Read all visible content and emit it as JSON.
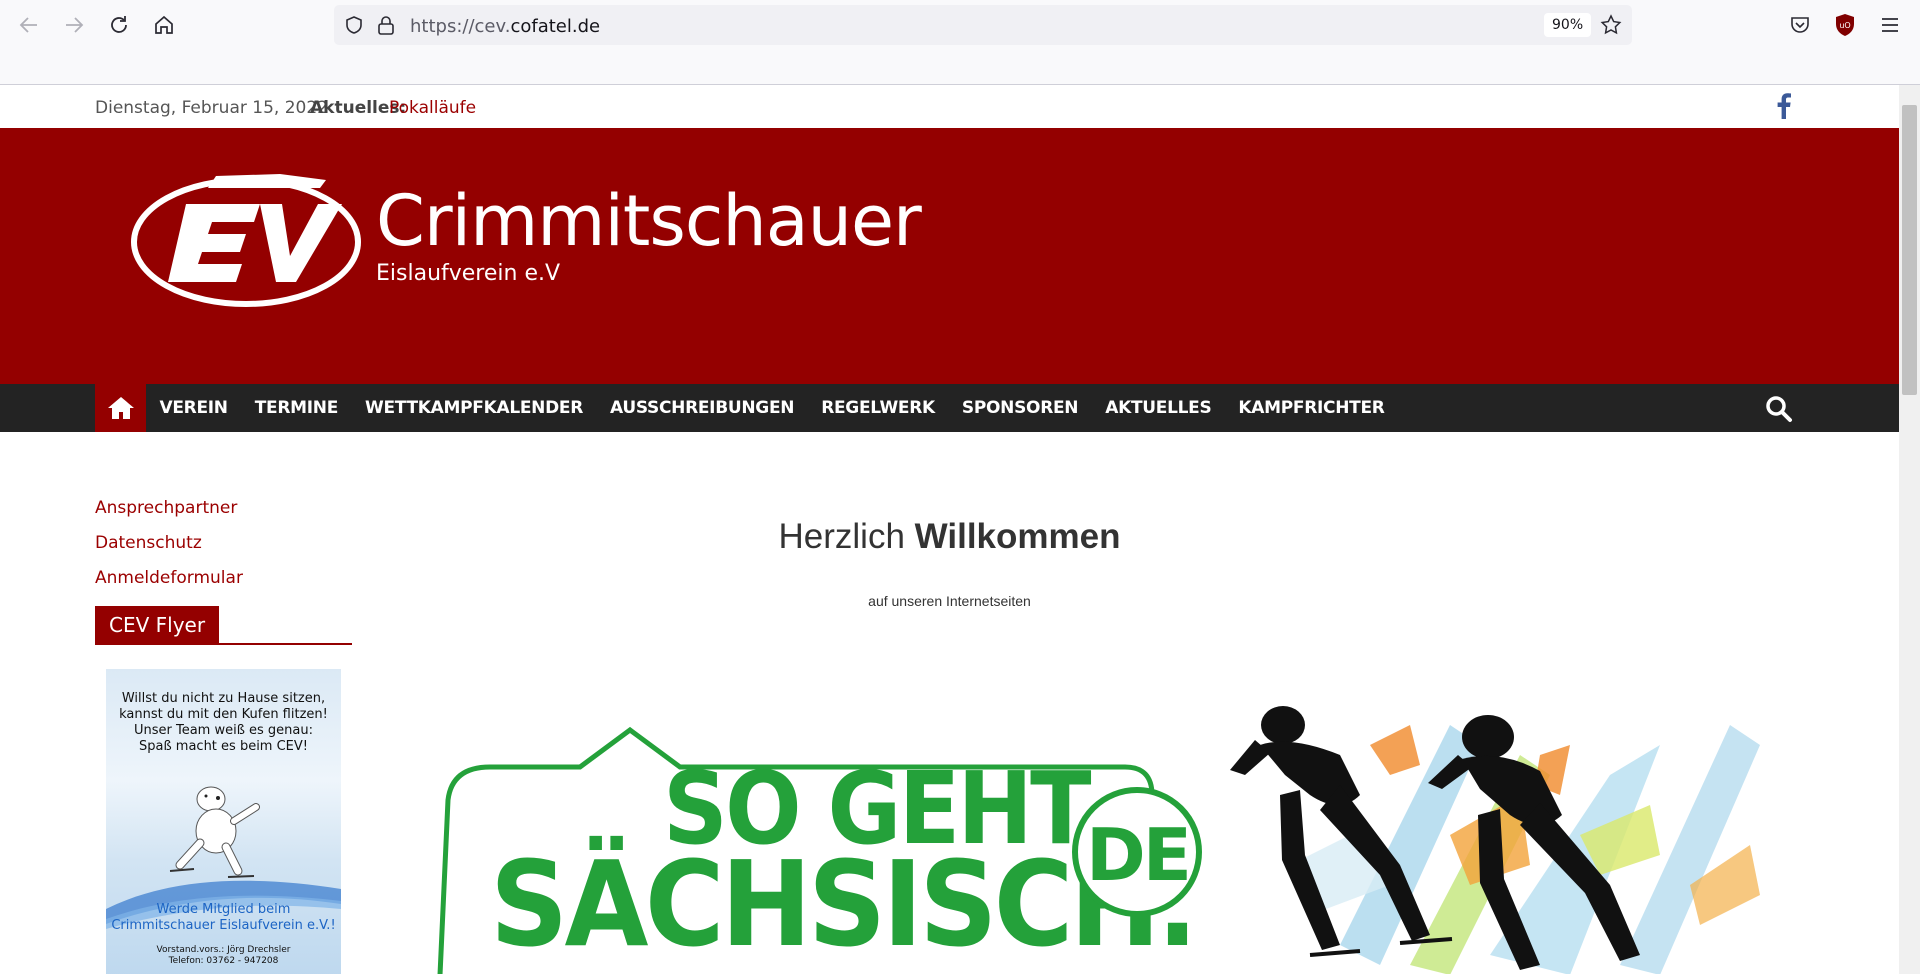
{
  "browser": {
    "url_prefix": "https://cev.",
    "url_domain": "cofatel.de",
    "zoom": "90%"
  },
  "topbar": {
    "date": "Dienstag, Februar 15, 2022",
    "news_label": "Aktuelles:",
    "news_link": "Pokalläufe"
  },
  "header": {
    "logo_letters": "EV",
    "title": "Crimmitschauer",
    "description": "Eislaufverein e.V"
  },
  "nav": {
    "items": [
      {
        "label": "VEREIN"
      },
      {
        "label": "TERMINE"
      },
      {
        "label": "WETTKAMPFKALENDER"
      },
      {
        "label": "AUSSCHREIBUNGEN"
      },
      {
        "label": "REGELWERK"
      },
      {
        "label": "SPONSOREN"
      },
      {
        "label": "AKTUELLES"
      },
      {
        "label": "KAMPFRICHTER"
      }
    ]
  },
  "sidebar": {
    "links": [
      {
        "label": "Ansprechpartner"
      },
      {
        "label": "Datenschutz"
      },
      {
        "label": "Anmeldeformular"
      }
    ],
    "widget_title": "CEV Flyer",
    "flyer": {
      "line1": "Willst du nicht zu Hause sitzen,",
      "line2": "kannst du mit den Kufen flitzen!",
      "line3": "Unser Team weiß es genau:",
      "line4": "Spaß macht es beim CEV!",
      "cta1": "Werde Mitglied beim",
      "cta2": "Crimmitschauer Eislaufverein e.V.!",
      "contact1": "Vorstand.vors.: Jörg Drechsler",
      "contact2": "Telefon: 03762 - 947208"
    }
  },
  "main": {
    "welcome_light": "Herzlich",
    "welcome_bold": "Willkommen",
    "welcome_sub": "auf unseren Internetseiten",
    "banner": {
      "line1": "SO GEHT",
      "line2": "SÄCHSISCH.",
      "badge": "DE"
    }
  },
  "colors": {
    "brand_red": "#940000",
    "link_red": "#9b0000",
    "nav_dark": "#232323",
    "slogan_green": "#24a13a"
  }
}
